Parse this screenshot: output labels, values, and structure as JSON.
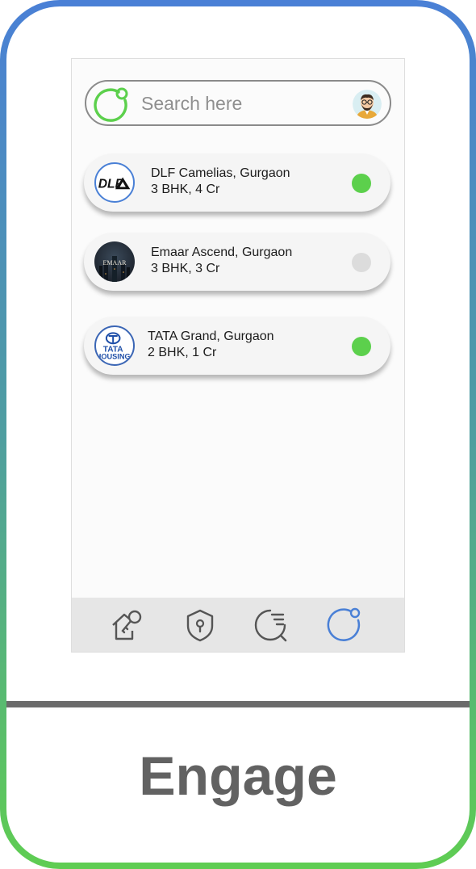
{
  "search": {
    "placeholder": "Search here"
  },
  "listings": [
    {
      "name": "DLF Camelias, Gurgaon",
      "detail": "3 BHK, 4 Cr",
      "logo_text": "DLF",
      "status_color": "#5cd04c"
    },
    {
      "name": "Emaar Ascend, Gurgaon",
      "detail": "3 BHK, 3 Cr",
      "logo_text": "EMAAR",
      "status_color": "#dcdcdc"
    },
    {
      "name": "TATA Grand, Gurgaon",
      "detail": "2 BHK, 1 Cr",
      "logo_text": "TATA\nHOUSING",
      "status_color": "#5cd04c"
    }
  ],
  "nav": [
    {
      "icon": "house-key-icon"
    },
    {
      "icon": "shield-keyhole-icon"
    },
    {
      "icon": "search-list-icon"
    },
    {
      "icon": "engage-ring-icon"
    }
  ],
  "caption": "Engage",
  "colors": {
    "accent_green": "#5cd04c",
    "accent_blue": "#4a80d6",
    "inactive_gray": "#dcdcdc"
  }
}
